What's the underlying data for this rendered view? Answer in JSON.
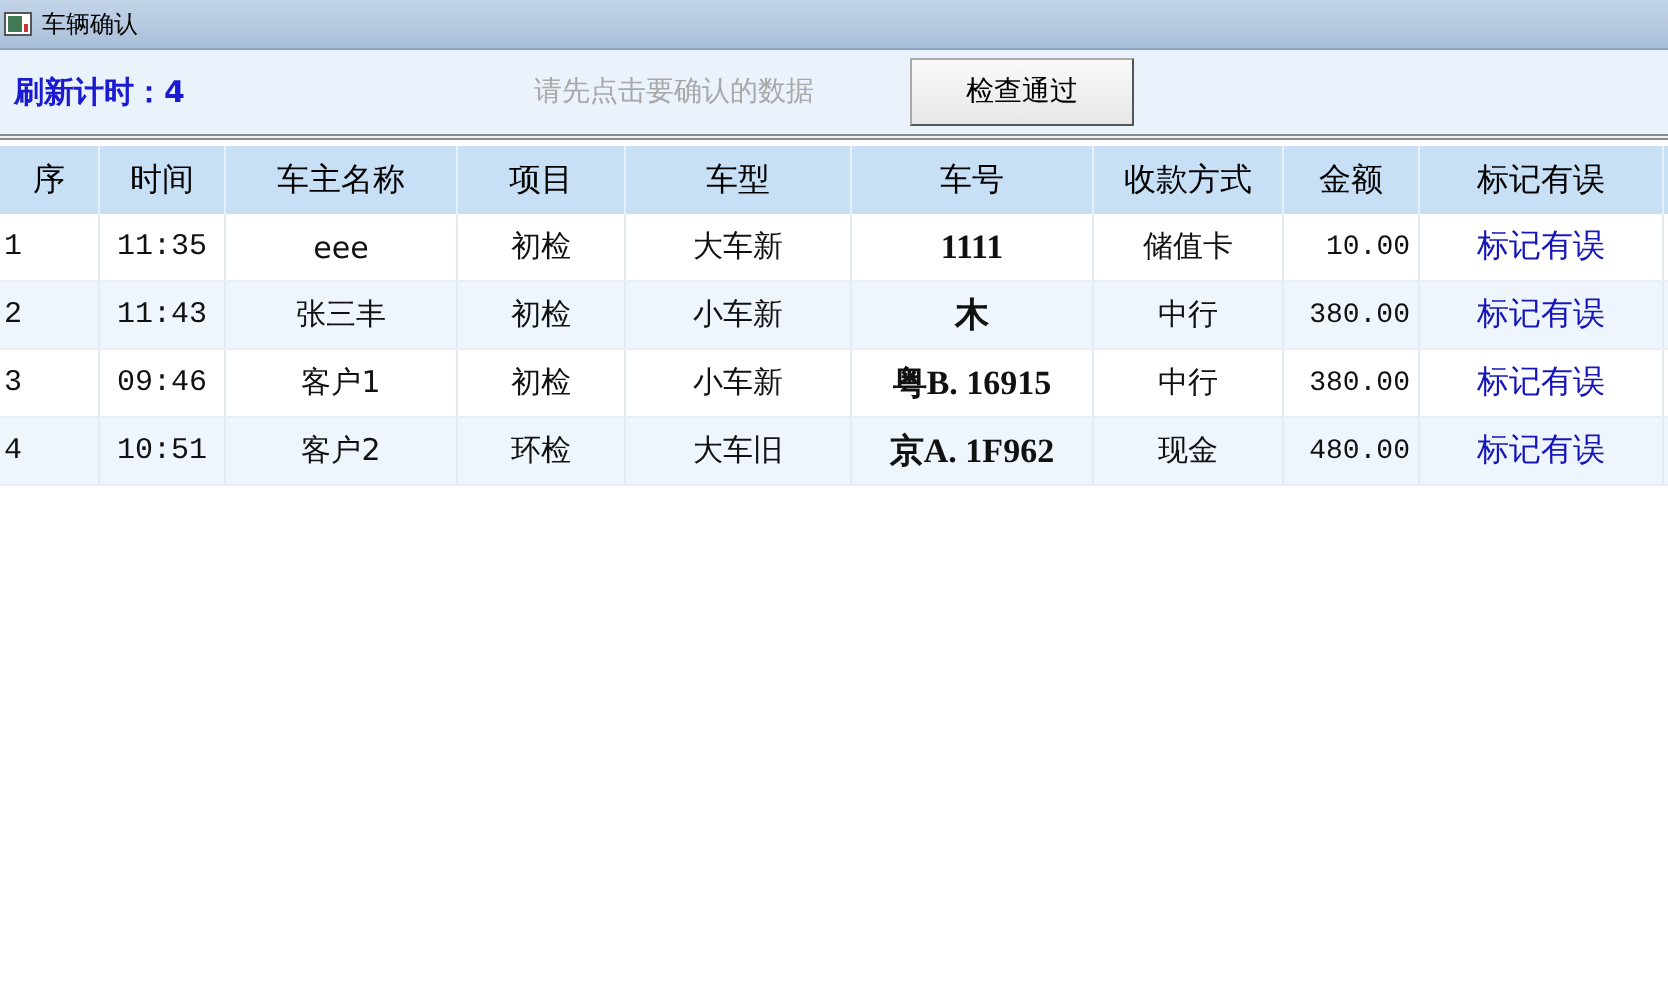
{
  "window": {
    "title": "车辆确认"
  },
  "toolbar": {
    "refresh_label": "刷新计时：4",
    "hint": "请先点击要确认的数据",
    "button": "检查通过"
  },
  "table": {
    "columns": [
      "序",
      "时间",
      "车主名称",
      "项目",
      "车型",
      "车号",
      "收款方式",
      "金额",
      "标记有误"
    ],
    "rows": [
      {
        "index": "1",
        "time": "11:35",
        "owner": "eee",
        "item": "初检",
        "vehicle_type": "大车新",
        "plate": "1111",
        "payment": "储值卡",
        "amount": "10.00",
        "action": "标记有误"
      },
      {
        "index": "2",
        "time": "11:43",
        "owner": "张三丰",
        "item": "初检",
        "vehicle_type": "小车新",
        "plate": "木",
        "payment": "中行",
        "amount": "380.00",
        "action": "标记有误"
      },
      {
        "index": "3",
        "time": "09:46",
        "owner": "客户1",
        "item": "初检",
        "vehicle_type": "小车新",
        "plate": "粤B. 16915",
        "payment": "中行",
        "amount": "380.00",
        "action": "标记有误"
      },
      {
        "index": "4",
        "time": "10:51",
        "owner": "客户2",
        "item": "环检",
        "vehicle_type": "大车旧",
        "plate": "京A. 1F962",
        "payment": "现金",
        "amount": "480.00",
        "action": "标记有误"
      }
    ]
  }
}
